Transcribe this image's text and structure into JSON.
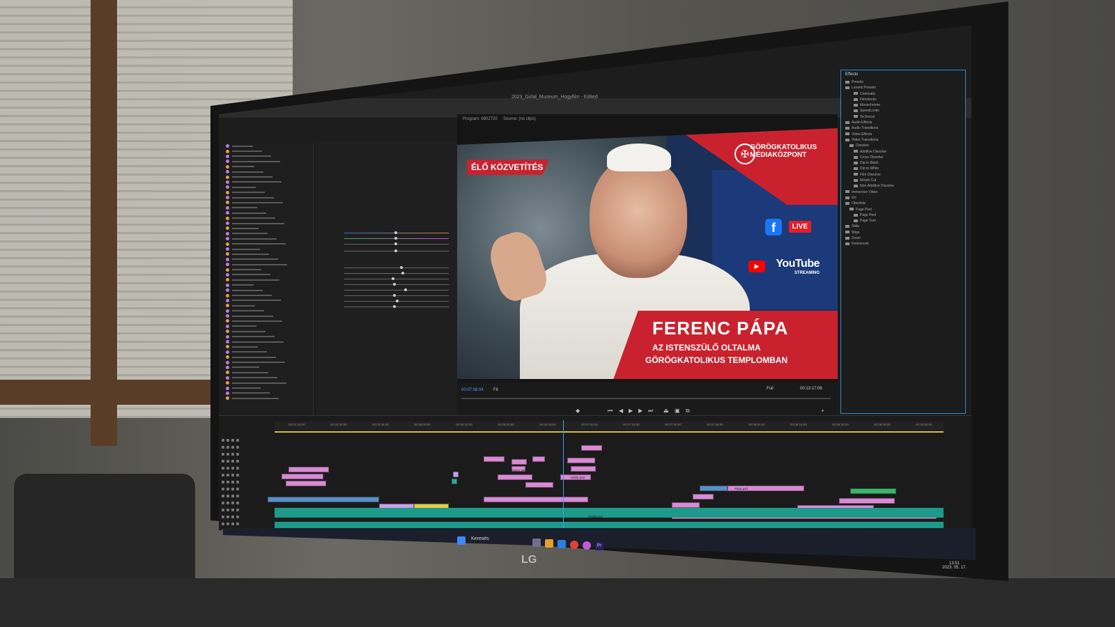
{
  "window": {
    "title": "2023_Girlal_Muzeum_Hogyfilm - Edited"
  },
  "program_monitor": {
    "tab": "Program: 6802720",
    "source_tab": "Source: (no clips)",
    "timecode_left": "00:07:08:04",
    "fit": "Fit",
    "quality": "Full",
    "timecode_right": "00:13:17:06"
  },
  "video_frame": {
    "live_label": "ÉLŐ KÖZVETÍTÉS",
    "brand_line1": "GÖRÖGKATOLIKUS",
    "brand_line2": "MÉDIAKÖZPONT",
    "facebook_letter": "f",
    "facebook_live": "LIVE",
    "youtube_text": "YouTube",
    "youtube_sub": "STREAMING",
    "name": "FERENC PÁPA",
    "subtitle_line1": "AZ ISTENSZÜLŐ OLTALMA",
    "subtitle_line2": "GÖRÖGKATOLIKUS TEMPLOMBAN"
  },
  "effects_panel": {
    "title": "Effects",
    "items": [
      "Presets",
      "Lumetri Presets",
      "Cinematic",
      "Filmstocks",
      "Monochrome",
      "SpeedLooks",
      "Technical",
      "Audio Effects",
      "Audio Transitions",
      "Video Effects",
      "Video Transitions",
      "Dissolve",
      "Additive Dissolve",
      "Cross Dissolve",
      "Dip to Black",
      "Dip to White",
      "Film Dissolve",
      "Morph Cut",
      "Non-Additive Dissolve",
      "Immersive Video",
      "Iris",
      "Obsolete",
      "Page Peel",
      "Page Peel",
      "Page Turn",
      "Slide",
      "Wipe",
      "Zoom",
      "Kedvencek"
    ]
  },
  "timeline": {
    "ruler": [
      "00:01:15:00",
      "00:02:30:00",
      "00:03:45:00",
      "00:05:00:00",
      "00:06:15:00",
      "00:06:00:00",
      "00:06:45:00",
      "00:07:00:00",
      "00:07:15:00",
      "00:07:30:00",
      "00:07:45:00",
      "00:08:00:00",
      "00:08:15:00",
      "00:08:30:00",
      "00:09:45:00",
      "00:10:00:00"
    ],
    "clip_labels": [
      "Pápa.psd",
      "DSKZ.JPG",
      "Hálók.psd",
      "Grafik.psd"
    ]
  },
  "taskbar": {
    "search": "Keresés",
    "time": "13:51",
    "date": "2023. 05. 17."
  },
  "monitor_brand": "LG",
  "colors": {
    "red": "#c9222e",
    "accent_blue": "#2d8ccf",
    "clip_pink": "#d78bd3",
    "audio_teal": "#1e9a8a"
  }
}
